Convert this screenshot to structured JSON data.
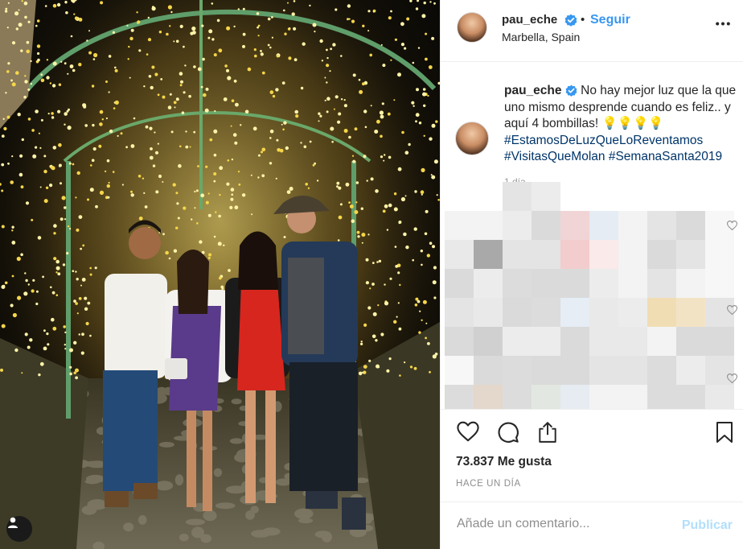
{
  "post": {
    "photo_alt": "",
    "photo_colors": {
      "light": "#fff3a8",
      "glow": "#f5d64a",
      "arch": "#6aa86a",
      "ground": "#6d6a58"
    }
  },
  "header": {
    "username": "pau_eche",
    "separator": "•",
    "follow_label": "Seguir",
    "location": "Marbella, Spain",
    "more_icon": "more-horizontal-icon"
  },
  "caption": {
    "username": "pau_eche",
    "text": " No hay mejor luz que la que uno mismo desprende cuando es feliz.. y aquí 4 bombillas! 💡💡💡💡",
    "hashtags": [
      "#EstamosDeLuzQueLoReventamos",
      "#VisitasQueMolan",
      "#SemanaSanta2019"
    ],
    "time_short": "1 día"
  },
  "actions": {
    "like_icon": "heart-icon",
    "comment_icon": "comment-icon",
    "share_icon": "share-icon",
    "save_icon": "bookmark-icon",
    "likes": "73.837 Me gusta",
    "time_ago": "HACE UN DÍA"
  },
  "comment_box": {
    "placeholder": "Añade un comentario...",
    "publish_label": "Publicar"
  },
  "colors": {
    "accent": "#3897f0",
    "hashtag": "#003569",
    "publish_disabled": "#b2dffc",
    "muted": "#8e8e8e"
  }
}
